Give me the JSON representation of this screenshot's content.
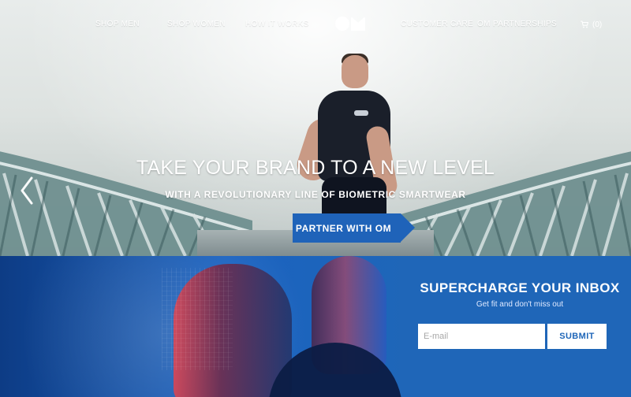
{
  "nav": {
    "items": [
      {
        "label": "SHOP MEN"
      },
      {
        "label": "SHOP WOMEN"
      },
      {
        "label": "HOW IT WORKS"
      },
      {
        "label": "CUSTOMER CARE"
      },
      {
        "label": "OM PARTNERSHIPS"
      }
    ],
    "cart": {
      "icon": "cart-icon",
      "label": "(0)"
    },
    "logo_text": "OM"
  },
  "hero": {
    "headline": "TAKE YOUR BRAND TO A NEW LEVEL",
    "subheadline": "WITH A REVOLUTIONARY LINE OF BIOMETRIC SMARTWEAR",
    "cta_label": "PARTNER WITH OM",
    "slider_prev_icon": "chevron-left-icon"
  },
  "signup": {
    "title": "SUPERCHARGE YOUR INBOX",
    "subtitle": "Get fit and don't miss out",
    "email_placeholder": "E-mail",
    "submit_label": "SUBMIT"
  },
  "colors": {
    "accent": "#1f66b8",
    "text_on_dark": "#ffffff"
  }
}
